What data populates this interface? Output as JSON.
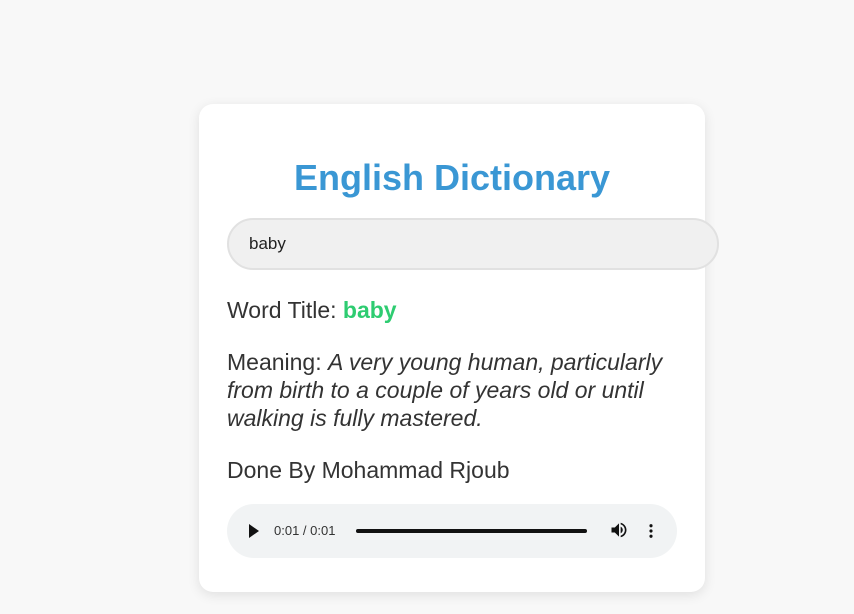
{
  "header": {
    "title": "English Dictionary"
  },
  "search": {
    "value": "baby",
    "placeholder": ""
  },
  "result": {
    "word_label": "Word Title:",
    "word": "baby",
    "meaning_label": "Meaning:",
    "meaning": "A very young human, particularly from birth to a couple of years old or until walking is fully mastered."
  },
  "footer": {
    "credit": "Done By Mohammad Rjoub"
  },
  "audio": {
    "time": "0:01 / 0:01",
    "progress": 1.0,
    "play_icon": "play-icon",
    "volume_icon": "volume-icon",
    "menu_icon": "more-vert-icon"
  },
  "colors": {
    "title": "#3a97d4",
    "word": "#2ecc71",
    "background": "#f8f8f8",
    "card": "#ffffff"
  }
}
